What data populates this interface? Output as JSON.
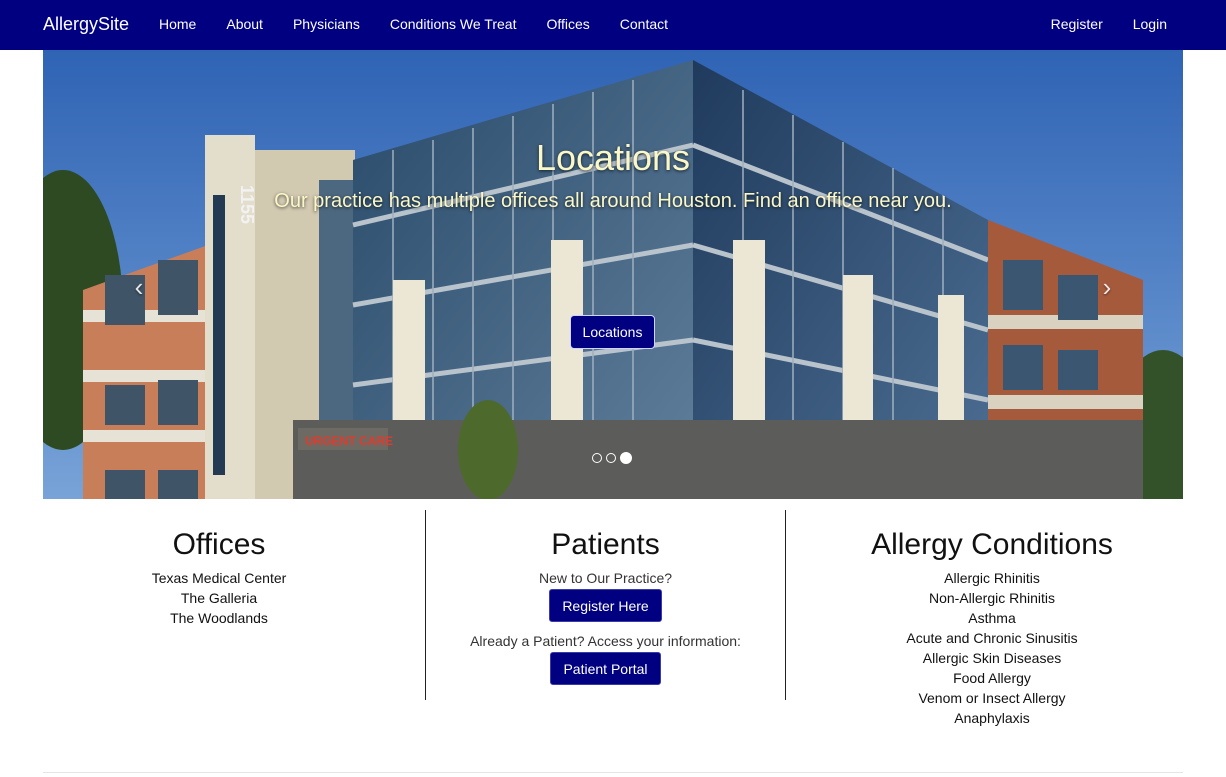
{
  "navbar": {
    "brand": "AllergySite",
    "left_items": [
      "Home",
      "About",
      "Physicians",
      "Conditions We Treat",
      "Offices",
      "Contact"
    ],
    "right_items": [
      "Register",
      "Login"
    ],
    "bg_color": "#000080"
  },
  "carousel": {
    "title": "Locations",
    "text": "Our practice has multiple offices all around Houston. Find an office near you.",
    "button_label": "Locations",
    "prev_icon": "chevron-left-icon",
    "next_icon": "chevron-right-icon",
    "slide_count": 3,
    "active_slide": 3,
    "building_number": "1155",
    "sign_text": "URGENT CARE"
  },
  "offices": {
    "heading": "Offices",
    "items": [
      "Texas Medical Center",
      "The Galleria",
      "The Woodlands"
    ]
  },
  "patients": {
    "heading": "Patients",
    "new_prompt": "New to Our Practice?",
    "register_label": "Register Here",
    "existing_prompt": "Already a Patient? Access your information:",
    "portal_label": "Patient Portal"
  },
  "conditions": {
    "heading": "Allergy Conditions",
    "items": [
      "Allergic Rhinitis",
      "Non-Allergic Rhinitis",
      "Asthma",
      "Acute and Chronic Sinusitis",
      "Allergic Skin Diseases",
      "Food Allergy",
      "Venom or Insect Allergy",
      "Anaphylaxis"
    ]
  }
}
